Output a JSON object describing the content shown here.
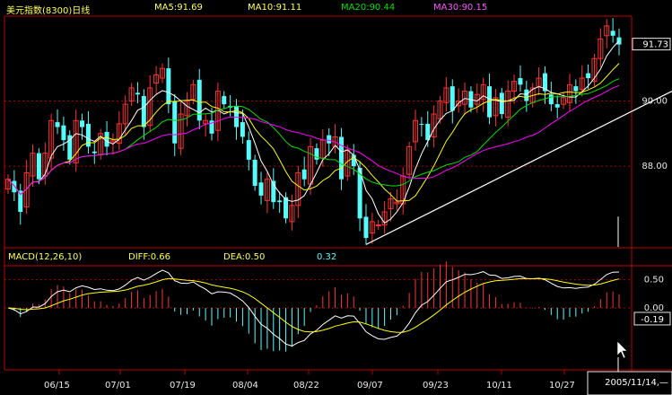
{
  "header": {
    "title": "美元指数(8300)日线",
    "ma5": "MA5:91.69",
    "ma10": "MA10:91.11",
    "ma20": "MA20:90.44",
    "ma30": "MA30:90.15"
  },
  "macd_header": {
    "label": "MACD(12,26,10)",
    "diff": "DIFF:0.66",
    "dea": "DEA:0.50",
    "value": "0.32"
  },
  "colors": {
    "up": "#ff3232",
    "down": "#54fcfc",
    "ma5": "#ffffff",
    "ma10": "#ffff00",
    "ma20": "#00e000",
    "ma30": "#ff00ff",
    "grid": "#b00000",
    "axis": "#c00000",
    "title": "#ffff54",
    "text": "#ffff54",
    "macd_value": "#54fcfc"
  },
  "chart_data": [
    {
      "type": "candlestick",
      "title": "美元指数(8300)日线",
      "xlabels": [
        "06/15",
        "07/01",
        "07/19",
        "08/04",
        "08/22",
        "09/07",
        "09/23",
        "10/11",
        "10/27"
      ],
      "x_date_range": [
        "2005-06-01",
        "2005-11-14"
      ],
      "ylim": [
        85.5,
        92.6
      ],
      "y_ticks": [
        88.0,
        90.0
      ],
      "y_tick_labels": [
        "88.00",
        "90.00"
      ],
      "last_price_label": "91.73",
      "close": [
        87.6,
        87.2,
        86.6,
        87.8,
        88.4,
        87.6,
        88.4,
        89.4,
        89.2,
        88.8,
        88.2,
        89.4,
        89.2,
        88.6,
        88.4,
        89.0,
        88.6,
        88.8,
        89.3,
        89.9,
        90.4,
        90.2,
        89.2,
        90.4,
        90.8,
        91.0,
        89.9,
        88.7,
        89.6,
        90.0,
        90.5,
        89.4,
        89.4,
        89.0,
        90.3,
        89.9,
        89.8,
        89.2,
        88.9,
        88.2,
        87.4,
        87.1,
        87.6,
        86.9,
        86.9,
        86.4,
        86.8,
        87.8,
        87.6,
        88.6,
        88.2,
        88.8,
        88.7,
        88.9,
        87.6,
        88.5,
        88.0,
        86.4,
        85.8,
        86.3,
        86.2,
        86.6,
        87.0,
        86.9,
        87.7,
        88.6,
        89.4,
        89.3,
        88.8,
        89.6,
        90.0,
        90.4,
        89.7,
        90.0,
        90.3,
        89.8,
        90.2,
        90.5,
        89.5,
        90.1,
        89.6,
        90.3,
        90.6,
        90.5,
        90.0,
        90.4,
        90.7,
        90.3,
        89.9,
        89.8,
        90.1,
        90.5,
        90.3,
        90.7,
        90.7,
        91.3,
        91.9,
        92.3,
        92.0,
        91.73
      ],
      "series": [
        {
          "name": "MA5",
          "value": 91.69
        },
        {
          "name": "MA10",
          "value": 91.11
        },
        {
          "name": "MA20",
          "value": 90.44
        },
        {
          "name": "MA30",
          "value": 90.15
        }
      ],
      "volume_last": 0.75
    },
    {
      "type": "macd",
      "title": "MACD(12,26,10)",
      "series": [
        {
          "name": "DIFF",
          "value": 0.66
        },
        {
          "name": "DEA",
          "value": 0.5
        },
        {
          "name": "MACD",
          "value": 0.32
        }
      ],
      "ylim": [
        -1.1,
        0.75
      ],
      "y_ticks": [
        0.0,
        0.5
      ],
      "y_tick_labels": [
        "0.00",
        "0.50"
      ],
      "cursor_value": "-0.19"
    }
  ],
  "status": {
    "date": "2005/11/14,—"
  }
}
